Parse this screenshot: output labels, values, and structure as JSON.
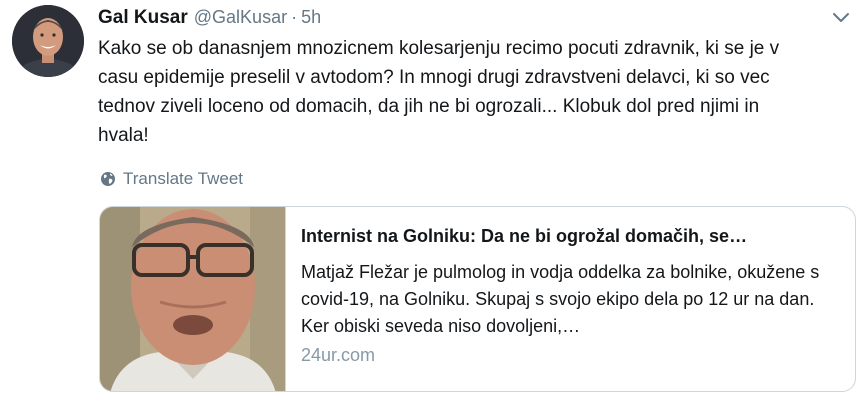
{
  "tweet": {
    "display_name": "Gal Kusar",
    "handle": "@GalKusar",
    "separator": "·",
    "time": "5h",
    "text": "Kako se ob danasnjem mnozicnem kolesarjenju recimo pocuti zdravnik, ki se je v\ncasu epidemije preselil v avtodom? In mnogi drugi zdravstveni delavci, ki so vec\ntednov ziveli loceno od domacih, da jih ne bi ogrozali... Klobuk dol pred njimi in\nhvala!",
    "translate_label": "Translate Tweet"
  },
  "card": {
    "title": "Internist na Golniku: Da ne bi ogrožal domačih, se…",
    "description": "Matjaž Fležar je pulmolog in vodja oddelka za bolnike, okužene s covid-19, na Golniku. Skupaj s svojo ekipo dela po 12 ur na dan. Ker obiski seveda niso dovoljeni,…",
    "domain": "24ur.com"
  },
  "icons": {
    "caret": "chevron-down-icon",
    "globe": "globe-icon"
  },
  "colors": {
    "text": "#14171a",
    "secondary": "#657786",
    "border": "#ccd6dd",
    "domain": "#8899a6"
  }
}
